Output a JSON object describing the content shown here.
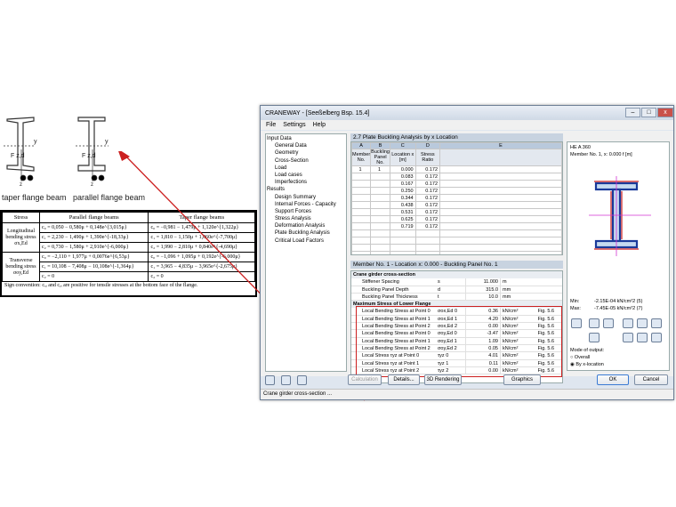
{
  "left_scan": {
    "beam_left_label": "taper flange beam",
    "beam_right_label": "parallel flange beam",
    "fz_label": "F z,d",
    "fz_label_2": "F z,d",
    "y_label": "y",
    "y_label_2": "y",
    "z_label": "z",
    "z_label_2": "z",
    "table": {
      "headers": [
        "Stress",
        "Parallel flange beams",
        "Taper flange beams"
      ],
      "rows": [
        {
          "stress": "Longitudinal bending stress σx,Ed",
          "parallel": [
            "c₀ = 0,050 − 0,580μ + 0,148e^{3,015μ}",
            "c₁ = 2,230 − 1,490μ + 1,390e^{-18,33μ}",
            "c₂ = 0,730 − 1,580μ + 2,910e^{-6,000μ}"
          ],
          "taper": [
            "c₀ = −0,981 − 1,479μ + 1,120e^{1,322μ}",
            "c₁ = 1,810 − 1,150μ + 1,060e^{-7,700μ}",
            "c₂ = 1,990 − 2,810μ + 0,840e^{-4,690μ}"
          ]
        },
        {
          "stress": "Transverse bending stress σoy,Ed",
          "parallel": [
            "c₀ = −2,110 + 1,977μ + 0,0076e^{6,53μ}",
            "c₁ = 10,108 − 7,408μ − 10,108e^{-1,364μ}",
            "c₂ = 0"
          ],
          "taper": [
            "c₀ = −1,096 + 1,095μ + 0,192e^{-6,000μ}",
            "c₁ = 3,965 − 4,835μ − 3,965e^{-2,675μ}",
            "c₂ = 0"
          ]
        }
      ],
      "sign_convention": "Sign convention: cₓᵢ and cᵧᵢ are positive for tensile stresses at the bottom face of the flange."
    }
  },
  "window": {
    "title": "CRANEWAY - [Seeßelberg Bsp. 15.4]",
    "menu": [
      "File",
      "Settings",
      "Help"
    ],
    "nav": [
      {
        "label": "Input Data",
        "level": 1
      },
      {
        "label": "General Data",
        "level": 2
      },
      {
        "label": "Geometry",
        "level": 2
      },
      {
        "label": "Cross-Section",
        "level": 2
      },
      {
        "label": "Load",
        "level": 2
      },
      {
        "label": "Load cases",
        "level": 2
      },
      {
        "label": "Imperfections",
        "level": 2
      },
      {
        "label": "Results",
        "level": 1
      },
      {
        "label": "Design Summary",
        "level": 2
      },
      {
        "label": "Internal Forces - Capacity",
        "level": 2
      },
      {
        "label": "Support Forces",
        "level": 2
      },
      {
        "label": "Stress Analysis",
        "level": 2
      },
      {
        "label": "Deformation Analysis",
        "level": 2
      },
      {
        "label": "Plate Buckling Analysis",
        "level": 2
      },
      {
        "label": "Critical Load Factors",
        "level": 2
      }
    ],
    "grid1": {
      "title": "2.7 Plate Buckling Analysis by x Location",
      "col_letters": [
        "A",
        "B",
        "C",
        "D",
        "E"
      ],
      "col_heads": [
        "Member No.",
        "Buckling Panel No.",
        "Location x [m]",
        "Stress Ratio",
        ""
      ],
      "member": "1",
      "panel": "1",
      "locations": [
        "0.000",
        "0.083",
        "0.167",
        "0.250",
        "0.344",
        "0.438",
        "0.531",
        "0.625",
        "0.719"
      ],
      "ratios": [
        "0.172",
        "0.172",
        "0.172",
        "0.172",
        "0.172",
        "0.172",
        "0.172",
        "0.172",
        "0.172"
      ]
    },
    "grid2": {
      "title": "Member No. 1 - Location x: 0.000 - Buckling Panel No. 1",
      "section1": "Crane girder cross-section",
      "rows1": [
        {
          "name": "Stiffener Spacing",
          "sym": "s",
          "val": "11.000",
          "unit": "m",
          "ref": ""
        },
        {
          "name": "Buckling Panel Depth",
          "sym": "d",
          "val": "315.0",
          "unit": "mm",
          "ref": ""
        },
        {
          "name": "Buckling Panel Thickness",
          "sym": "t",
          "val": "10.0",
          "unit": "mm",
          "ref": ""
        }
      ],
      "section2": "Maximum Stress of Lower Flange",
      "rows2": [
        {
          "name": "Local Bending Stress at Point 0",
          "sym": "σox,Ed 0",
          "val": "0.36",
          "unit": "kN/cm²",
          "ref": "Fig. 5.6"
        },
        {
          "name": "Local Bending Stress at Point 1",
          "sym": "σox,Ed 1",
          "val": "4.20",
          "unit": "kN/cm²",
          "ref": "Fig. 5.6"
        },
        {
          "name": "Local Bending Stress at Point 2",
          "sym": "σox,Ed 2",
          "val": "0.00",
          "unit": "kN/cm²",
          "ref": "Fig. 5.6"
        },
        {
          "name": "Local Bending Stress at Point 0",
          "sym": "σoy,Ed 0",
          "val": "-3.47",
          "unit": "kN/cm²",
          "ref": "Fig. 5.6"
        },
        {
          "name": "Local Bending Stress at Point 1",
          "sym": "σoy,Ed 1",
          "val": "1.09",
          "unit": "kN/cm²",
          "ref": "Fig. 5.6"
        },
        {
          "name": "Local Bending Stress at Point 2",
          "sym": "σoy,Ed 2",
          "val": "0.05",
          "unit": "kN/cm²",
          "ref": "Fig. 5.6"
        },
        {
          "name": "Local Stress τyz at Point 0",
          "sym": "τyz 0",
          "val": "4.01",
          "unit": "kN/cm²",
          "ref": "Fig. 5.6"
        },
        {
          "name": "Local Stress τyz at Point 1",
          "sym": "τyz 1",
          "val": "0.11",
          "unit": "kN/cm²",
          "ref": "Fig. 5.6"
        },
        {
          "name": "Local Stress τyz at Point 2",
          "sym": "τyz 2",
          "val": "0.00",
          "unit": "kN/cm²",
          "ref": "Fig. 5.6"
        }
      ]
    },
    "side": {
      "section": "HE A 360",
      "member_info": "Member No. 1, x: 0.000 f [m]",
      "min_label": "Min:",
      "min_val": "-2.15E-04  kN/cm²2 (5)",
      "max_label": "Max:",
      "max_val": "-7.45E-05  kN/cm²2 (7)",
      "mode_label": "Mode of output:",
      "opt_overall": "Overall",
      "opt_by_x": "By x-location"
    },
    "buttons": {
      "calculation": "Calculation",
      "details": "Details...",
      "rendering": "3D Rendering",
      "graphics": "Graphics",
      "ok": "OK",
      "cancel": "Cancel"
    },
    "status": "Crane girder cross-section ..."
  },
  "colors": {
    "highlight_red": "#cc2020",
    "header_blue": "#c8d3e0"
  }
}
